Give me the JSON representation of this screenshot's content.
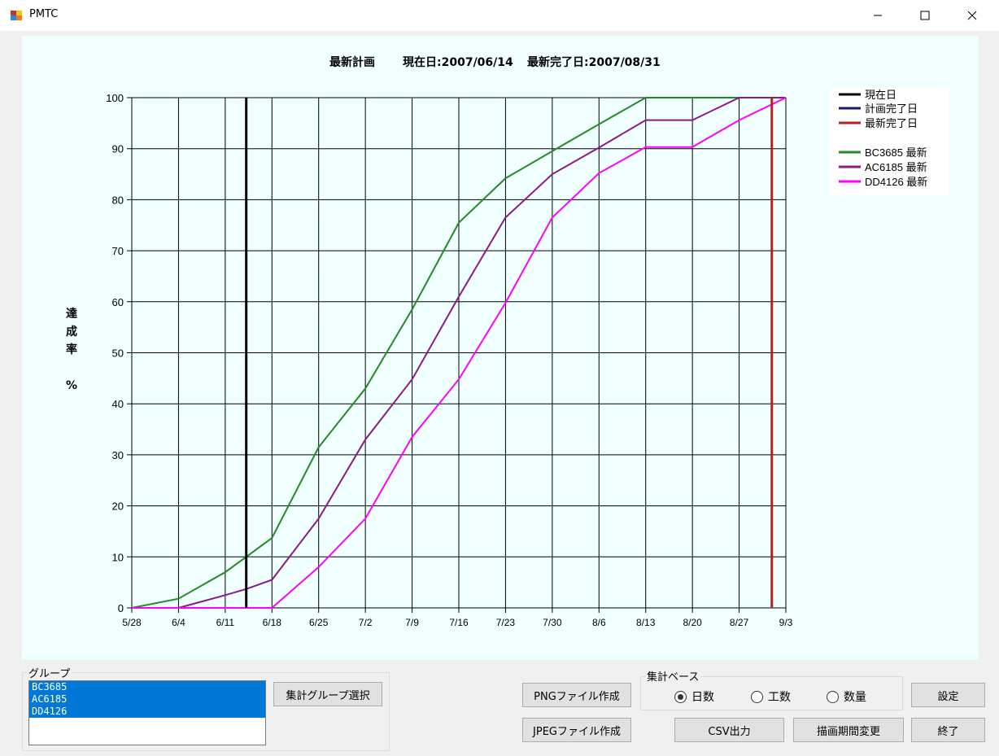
{
  "window": {
    "title": "PMTC"
  },
  "chart_data": {
    "type": "line",
    "title": "最新計画",
    "current_date_label": "現在日:2007/06/14",
    "latest_completion_label": "最新完了日:2007/08/31",
    "ylabel_chars": [
      "達",
      "成",
      "率",
      "",
      "%"
    ],
    "categories": [
      "5/28",
      "6/4",
      "6/11",
      "6/18",
      "6/25",
      "7/2",
      "7/9",
      "7/16",
      "7/23",
      "7/30",
      "8/6",
      "8/13",
      "8/20",
      "8/27",
      "9/3"
    ],
    "ylim": [
      0,
      100
    ],
    "yticks": [
      0,
      10,
      20,
      30,
      40,
      50,
      60,
      70,
      80,
      90,
      100
    ],
    "grid": true,
    "legend_position": "top-right",
    "current_date_index": 2.45,
    "latest_completion_index": 13.7,
    "series": [
      {
        "name": "BC3685 最新",
        "color": "#228b22",
        "points": [
          [
            0,
            0
          ],
          [
            1,
            1.8
          ],
          [
            2,
            7
          ],
          [
            2.45,
            10
          ],
          [
            3,
            13.7
          ],
          [
            4,
            31.5
          ],
          [
            5,
            43
          ],
          [
            6,
            58.5
          ],
          [
            7,
            75.5
          ],
          [
            8,
            84.2
          ],
          [
            9,
            89.5
          ],
          [
            10,
            94.8
          ],
          [
            11,
            100
          ],
          [
            12,
            100
          ],
          [
            13,
            100
          ],
          [
            14,
            100
          ]
        ]
      },
      {
        "name": "AC6185 最新",
        "color": "#8b1a89",
        "points": [
          [
            0,
            0
          ],
          [
            1,
            0
          ],
          [
            2,
            2.5
          ],
          [
            2.45,
            3.7
          ],
          [
            3,
            5.5
          ],
          [
            4,
            17.5
          ],
          [
            5,
            33
          ],
          [
            6,
            44.8
          ],
          [
            7,
            61
          ],
          [
            8,
            76.5
          ],
          [
            9,
            85
          ],
          [
            10,
            90.2
          ],
          [
            11,
            95.6
          ],
          [
            12,
            95.6
          ],
          [
            13,
            100
          ],
          [
            14,
            100
          ]
        ]
      },
      {
        "name": "DD4126 最新",
        "color": "#ff00ff",
        "points": [
          [
            0,
            0
          ],
          [
            1,
            0
          ],
          [
            2,
            0
          ],
          [
            3,
            0
          ],
          [
            4,
            8
          ],
          [
            5,
            17.5
          ],
          [
            6,
            33.5
          ],
          [
            7,
            44.8
          ],
          [
            8,
            59.8
          ],
          [
            9,
            76.5
          ],
          [
            10,
            85.2
          ],
          [
            11,
            90.3
          ],
          [
            12,
            90.3
          ],
          [
            13,
            95.6
          ],
          [
            14,
            100
          ]
        ]
      }
    ],
    "legend": [
      {
        "label": "現在日",
        "color": "#000000"
      },
      {
        "label": "計画完了日",
        "color": "#191970"
      },
      {
        "label": "最新完了日",
        "color": "#b22222"
      },
      {
        "label": "BC3685 最新",
        "color": "#228b22"
      },
      {
        "label": "AC6185 最新",
        "color": "#8b1a89"
      },
      {
        "label": "DD4126 最新",
        "color": "#ff00ff"
      }
    ]
  },
  "group": {
    "label": "グループ",
    "items": [
      "BC3685",
      "AC6185",
      "DD4126"
    ],
    "select_button": "集計グループ選択"
  },
  "buttons": {
    "png": "PNGファイル作成",
    "jpeg": "JPEGファイル作成",
    "csv": "CSV出力",
    "period": "描画期間変更",
    "settings": "設定",
    "exit": "終了"
  },
  "aggregation": {
    "label": "集計ベース",
    "options": [
      "日数",
      "工数",
      "数量"
    ],
    "selected": "日数"
  }
}
